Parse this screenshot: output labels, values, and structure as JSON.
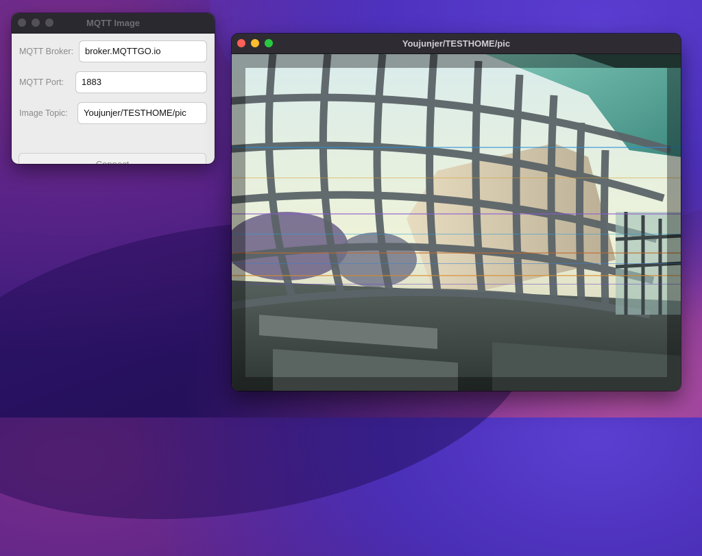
{
  "settings_window": {
    "title": "MQTT Image",
    "broker_label": "MQTT Broker:",
    "broker_value": "broker.MQTTGO.io",
    "port_label": "MQTT Port:",
    "port_value": "1883",
    "topic_label": "Image Topic:",
    "topic_value": "Youjunjer/TESTHOME/pic",
    "connect_label": "Connect"
  },
  "image_window": {
    "title": "Youjunjer/TESTHOME/pic",
    "image_icon": "camera-feed-photo"
  },
  "colors": {
    "close": "#fe5f57",
    "minimize": "#febc2e",
    "zoom": "#28c840"
  }
}
